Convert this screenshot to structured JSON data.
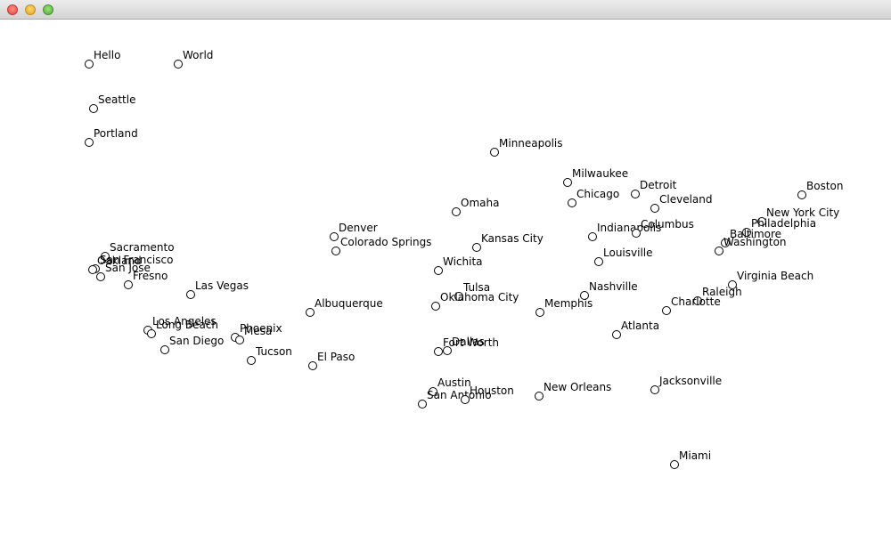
{
  "window": {
    "title": "",
    "controls": [
      "close-button",
      "minimize-button",
      "zoom-button"
    ]
  },
  "points": [
    {
      "label": "Hello"
    },
    {
      "label": "World"
    },
    {
      "label": "Seattle"
    },
    {
      "label": "Portland"
    },
    {
      "label": "Minneapolis"
    },
    {
      "label": "Milwaukee"
    },
    {
      "label": "Chicago"
    },
    {
      "label": "Detroit"
    },
    {
      "label": "Cleveland"
    },
    {
      "label": "Boston"
    },
    {
      "label": "New York City"
    },
    {
      "label": "Philadelphia"
    },
    {
      "label": "Baltimore"
    },
    {
      "label": "Washington"
    },
    {
      "label": "Omaha"
    },
    {
      "label": "Denver"
    },
    {
      "label": "Colorado Springs"
    },
    {
      "label": "Kansas City"
    },
    {
      "label": "Indianapolis"
    },
    {
      "label": "Columbus"
    },
    {
      "label": "Louisville"
    },
    {
      "label": "Sacramento"
    },
    {
      "label": "San Francisco"
    },
    {
      "label": "Oakland"
    },
    {
      "label": "San Jose"
    },
    {
      "label": "Fresno"
    },
    {
      "label": "Las Vegas"
    },
    {
      "label": "Wichita"
    },
    {
      "label": "Tulsa"
    },
    {
      "label": "Oklahoma City"
    },
    {
      "label": "Virginia Beach"
    },
    {
      "label": "Raleigh"
    },
    {
      "label": "Charlotte"
    },
    {
      "label": "Nashville"
    },
    {
      "label": "Memphis"
    },
    {
      "label": "Albuquerque"
    },
    {
      "label": "Los Angeles"
    },
    {
      "label": "Long Beach"
    },
    {
      "label": "San Diego"
    },
    {
      "label": "Phoenix"
    },
    {
      "label": "Mesa"
    },
    {
      "label": "Tucson"
    },
    {
      "label": "Atlanta"
    },
    {
      "label": "El Paso"
    },
    {
      "label": "Fort Worth"
    },
    {
      "label": "Dallas"
    },
    {
      "label": "Austin"
    },
    {
      "label": "San Antonio"
    },
    {
      "label": "Houston"
    },
    {
      "label": "New Orleans"
    },
    {
      "label": "Jacksonville"
    },
    {
      "label": "Miami"
    }
  ]
}
